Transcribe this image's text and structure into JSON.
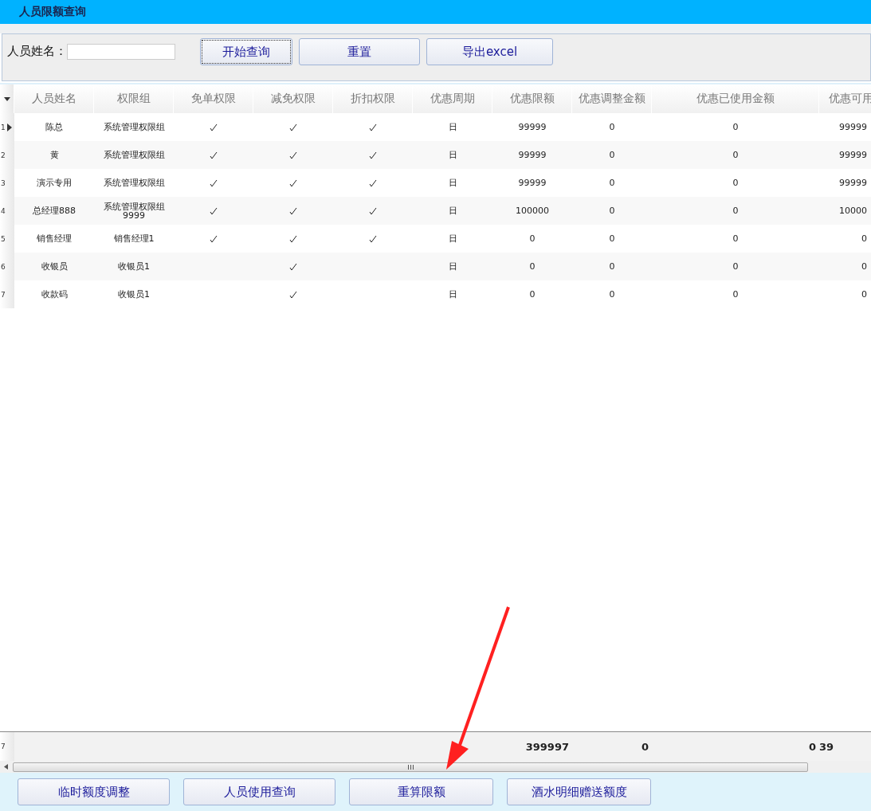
{
  "window": {
    "title": "人员限额查询"
  },
  "search": {
    "label": "人员姓名：",
    "buttons": [
      {
        "label": "开始查询",
        "focused": true
      },
      {
        "label": "重置",
        "focused": false
      },
      {
        "label": "导出excel",
        "focused": false
      }
    ]
  },
  "table": {
    "columns": [
      "人员姓名",
      "权限组",
      "免单权限",
      "减免权限",
      "折扣权限",
      "优惠周期",
      "优惠限额",
      "优惠调整金额",
      "优惠已使用金额",
      "优惠可用"
    ],
    "rows": [
      {
        "index": "1",
        "selected": true,
        "name": "陈总",
        "group": "系统管理权限组",
        "free": true,
        "reduce": true,
        "discount": true,
        "period": "日",
        "limit": "99999",
        "adjust": "0",
        "used": "0",
        "available": "99999"
      },
      {
        "index": "2",
        "selected": false,
        "name": "黄",
        "group": "系统管理权限组",
        "free": true,
        "reduce": true,
        "discount": true,
        "period": "日",
        "limit": "99999",
        "adjust": "0",
        "used": "0",
        "available": "99999"
      },
      {
        "index": "3",
        "selected": false,
        "name": "演示专用",
        "group": "系统管理权限组",
        "free": true,
        "reduce": true,
        "discount": true,
        "period": "日",
        "limit": "99999",
        "adjust": "0",
        "used": "0",
        "available": "99999"
      },
      {
        "index": "4",
        "selected": false,
        "name": "总经理888",
        "group": "系统管理权限组9999",
        "free": true,
        "reduce": true,
        "discount": true,
        "period": "日",
        "limit": "100000",
        "adjust": "0",
        "used": "0",
        "available": "10000"
      },
      {
        "index": "5",
        "selected": false,
        "name": "销售经理",
        "group": "销售经理1",
        "free": true,
        "reduce": true,
        "discount": true,
        "period": "日",
        "limit": "0",
        "adjust": "0",
        "used": "0",
        "available": "0"
      },
      {
        "index": "6",
        "selected": false,
        "name": "收银员",
        "group": "收银员1",
        "free": false,
        "reduce": true,
        "discount": false,
        "period": "日",
        "limit": "0",
        "adjust": "0",
        "used": "0",
        "available": "0"
      },
      {
        "index": "7",
        "selected": false,
        "name": "收款码",
        "group": "收银员1",
        "free": false,
        "reduce": true,
        "discount": false,
        "period": "日",
        "limit": "0",
        "adjust": "0",
        "used": "0",
        "available": "0"
      }
    ],
    "footer": {
      "count": "7",
      "limit": "399997",
      "adjust": "0",
      "used": "0",
      "available": "39"
    }
  },
  "buttons": [
    "临时额度调整",
    "人员使用查询",
    "重算限额",
    "酒水明细赠送额度"
  ]
}
